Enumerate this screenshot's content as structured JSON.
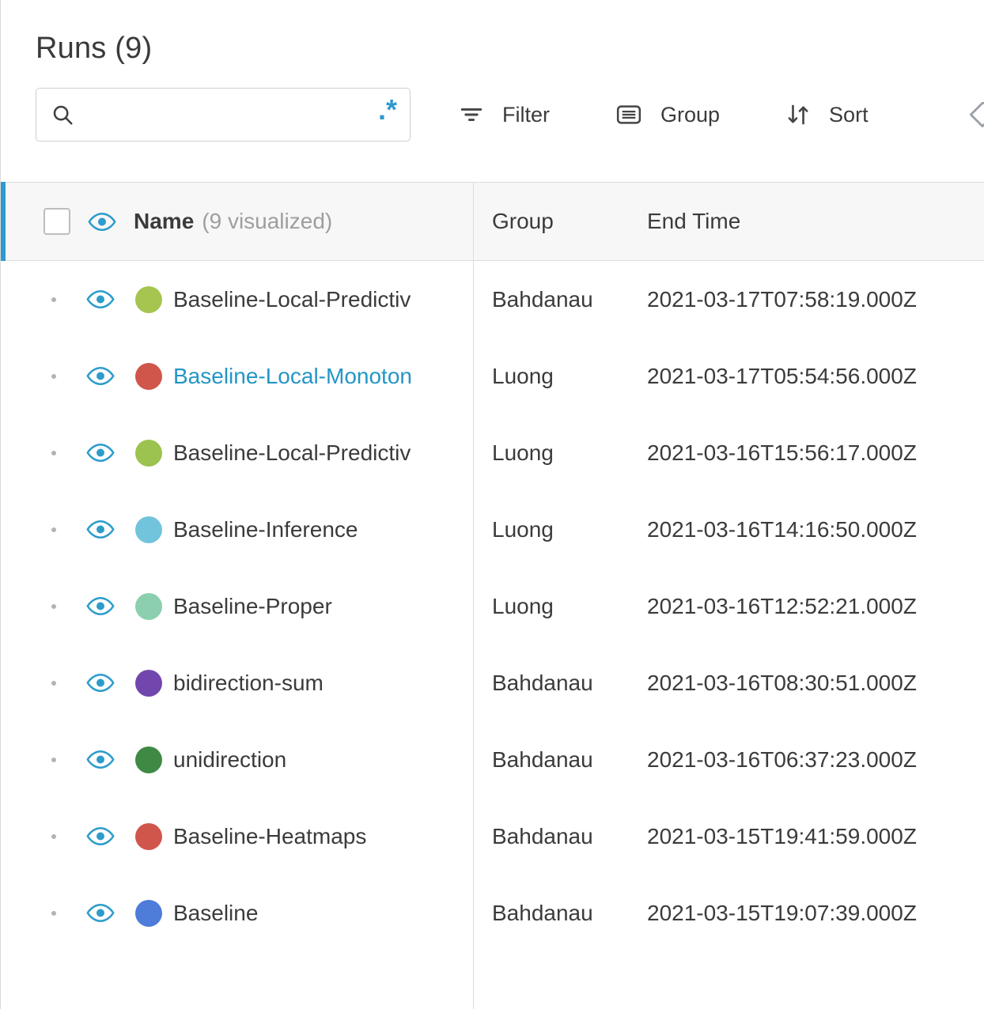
{
  "header": {
    "title": "Runs (9)",
    "search": {
      "value": "",
      "placeholder": "",
      "regex_label": ".*"
    },
    "toolbar": {
      "filter": "Filter",
      "group": "Group",
      "sort": "Sort"
    }
  },
  "table": {
    "header": {
      "name_label": "Name",
      "name_sublabel": "(9 visualized)",
      "group_label": "Group",
      "end_time_label": "End Time"
    },
    "rows": [
      {
        "name": "Baseline-Local-Predictiv",
        "color": "#a6c550",
        "group": "Bahdanau",
        "end_time": "2021-03-17T07:58:19.000Z",
        "selected": false
      },
      {
        "name": "Baseline-Local-Monoton",
        "color": "#d0564b",
        "group": "Luong",
        "end_time": "2021-03-17T05:54:56.000Z",
        "selected": true
      },
      {
        "name": "Baseline-Local-Predictiv",
        "color": "#9cc24f",
        "group": "Luong",
        "end_time": "2021-03-16T15:56:17.000Z",
        "selected": false
      },
      {
        "name": "Baseline-Inference",
        "color": "#72c3dc",
        "group": "Luong",
        "end_time": "2021-03-16T14:16:50.000Z",
        "selected": false
      },
      {
        "name": "Baseline-Proper",
        "color": "#8ccfae",
        "group": "Luong",
        "end_time": "2021-03-16T12:52:21.000Z",
        "selected": false
      },
      {
        "name": "bidirection-sum",
        "color": "#7247ad",
        "group": "Bahdanau",
        "end_time": "2021-03-16T08:30:51.000Z",
        "selected": false
      },
      {
        "name": "unidirection",
        "color": "#3e8a44",
        "group": "Bahdanau",
        "end_time": "2021-03-16T06:37:23.000Z",
        "selected": false
      },
      {
        "name": "Baseline-Heatmaps",
        "color": "#d0564b",
        "group": "Bahdanau",
        "end_time": "2021-03-15T19:41:59.000Z",
        "selected": false
      },
      {
        "name": "Baseline",
        "color": "#4d7cd9",
        "group": "Bahdanau",
        "end_time": "2021-03-15T19:07:39.000Z",
        "selected": false
      }
    ]
  },
  "colors": {
    "accent_blue": "#2e99cc",
    "eye_blue": "#2d9ccb",
    "link_blue": "#2496c5"
  }
}
